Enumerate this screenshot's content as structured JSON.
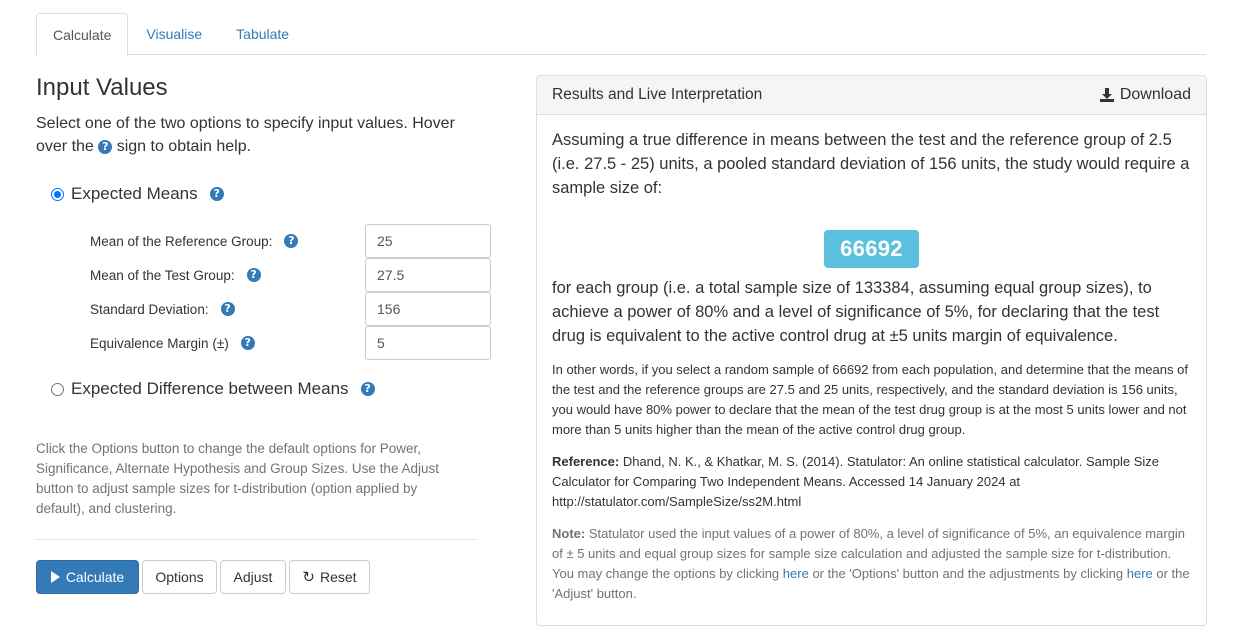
{
  "tabs": [
    "Calculate",
    "Visualise",
    "Tabulate"
  ],
  "left": {
    "title": "Input Values",
    "intro_a": "Select one of the two options to specify input values. Hover over the",
    "intro_b": "sign to obtain help.",
    "option_means": "Expected Means",
    "option_difference": "Expected Difference between Means",
    "fields": [
      {
        "label": "Mean of the Reference Group:",
        "value": "25"
      },
      {
        "label": "Mean of the Test Group:",
        "value": "27.5"
      },
      {
        "label": "Standard Deviation:",
        "value": "156"
      },
      {
        "label": "Equivalence Margin (±)",
        "value": "5"
      }
    ],
    "help_text": "Click the Options button to change the default options for Power, Significance, Alternate Hypothesis and Group Sizes. Use the Adjust button to adjust sample sizes for t-distribution (option applied by default), and clustering.",
    "buttons": {
      "calculate": "Calculate",
      "options": "Options",
      "adjust": "Adjust",
      "reset": "Reset"
    }
  },
  "panel": {
    "title": "Results and Live Interpretation",
    "download": "Download",
    "para1": "Assuming a true difference in means between the test and the reference group of 2.5 (i.e. 27.5 - 25) units, a pooled standard deviation of 156 units, the study would require a sample size of:",
    "result": "66692",
    "para2": "for each group (i.e. a total sample size of 133384, assuming equal group sizes), to achieve a power of 80% and a level of significance of 5%, for declaring that the test drug is equivalent to the active control drug at ±5 units margin of equivalence.",
    "para3": "In other words, if you select a random sample of 66692 from each population, and determine that the means of the test and the reference groups are 27.5 and 25 units, respectively, and the standard deviation is 156 units, you would have 80% power to declare that the mean of the test drug group is at the most 5 units lower and not more than 5 units higher than the mean of the active control drug group.",
    "reference_label": "Reference:",
    "reference_text": "Dhand, N. K., & Khatkar, M. S. (2014). Statulator: An online statistical calculator. Sample Size Calculator for Comparing Two Independent Means. Accessed 14 January 2024 at http://statulator.com/SampleSize/ss2M.html",
    "note_label": "Note:",
    "note_a": "Statulator used the input values of a power of 80%, a level of significance of 5%, an equivalence margin of ± 5 units and equal group sizes for sample size calculation and adjusted the sample size for t-distribution. You may change the options by clicking",
    "note_link1": "here",
    "note_b": "or the 'Options' button and the adjustments by clicking",
    "note_link2": "here",
    "note_c": "or the 'Adjust' button."
  },
  "colors": {
    "primary": "#337ab7",
    "badge": "#5bc0de",
    "muted": "#737373"
  }
}
